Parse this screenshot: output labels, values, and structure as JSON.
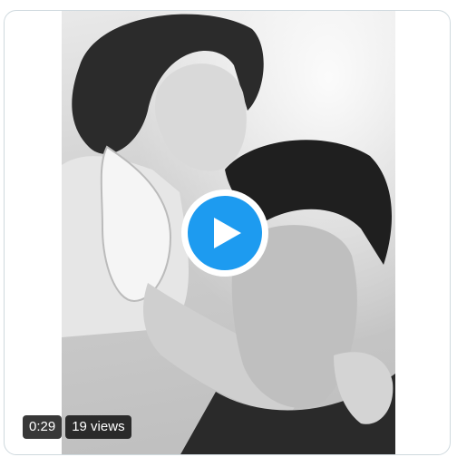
{
  "media": {
    "play_icon": "play-icon",
    "accent_color": "#1d9bf0",
    "duration": "0:29",
    "views": "19 views"
  }
}
